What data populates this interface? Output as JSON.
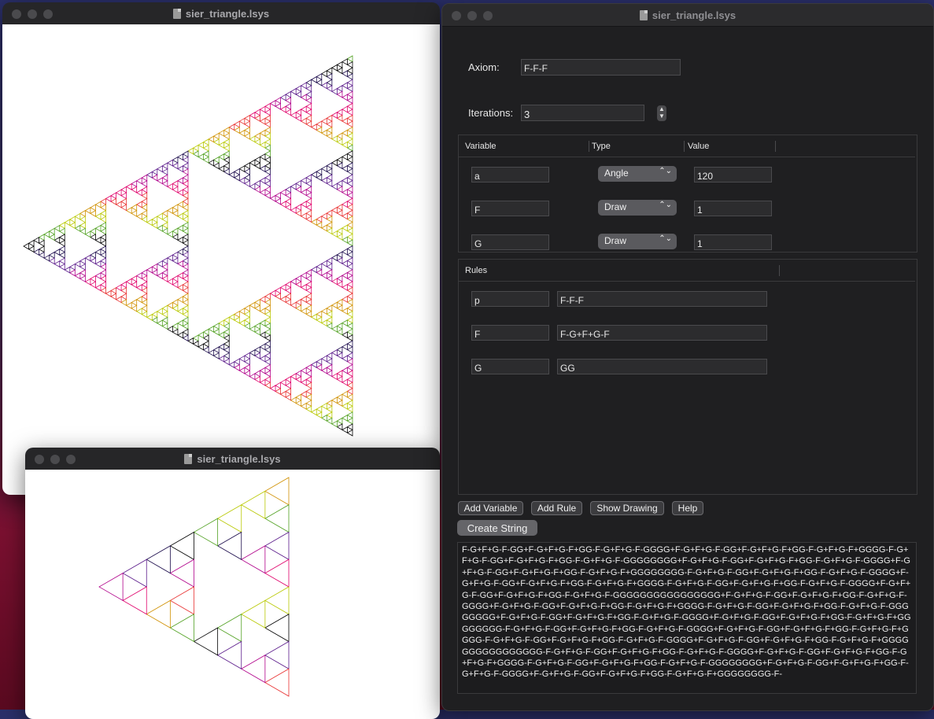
{
  "window_title": "sier_triangle.lsys",
  "axiom": {
    "label": "Axiom:",
    "value": "F-F-F"
  },
  "iterations": {
    "label": "Iterations:",
    "value": "3"
  },
  "variables": {
    "headers": [
      "Variable",
      "Type",
      "Value"
    ],
    "rows": [
      {
        "name": "a",
        "type": "Angle",
        "value": "120"
      },
      {
        "name": "F",
        "type": "Draw",
        "value": "1"
      },
      {
        "name": "G",
        "type": "Draw",
        "value": "1"
      }
    ]
  },
  "rules": {
    "header": "Rules",
    "rows": [
      {
        "name": "p",
        "value": "F-F-F"
      },
      {
        "name": "F",
        "value": "F-G+F+G-F"
      },
      {
        "name": "G",
        "value": "GG"
      }
    ]
  },
  "buttons": {
    "add_variable": "Add Variable",
    "add_rule": "Add Rule",
    "show_drawing": "Show Drawing",
    "help": "Help",
    "create_string": "Create String"
  },
  "icons": {
    "window_controls": "traffic-light-icons",
    "document": "document-icon",
    "popup": "chevron-up-down-icon",
    "stepper": "stepper-arrows-icon"
  },
  "drawing": {
    "shape": "sierpinski-triangle",
    "large_depth": 6,
    "small_depth": 3,
    "colors": [
      "#000000",
      "#1a0a4a",
      "#5a1a8a",
      "#b0008a",
      "#e0006a",
      "#e83030",
      "#d09000",
      "#b8c800",
      "#50a020"
    ]
  },
  "output_text": "F-G+F+G-F-GG+F-G+F+G-F+GG-F-G+F+G-F-GGGG+F-G+F+G-F-GG+F-G+F+G-F+GG-F-G+F+G-F+GGGG-F-G+F+G-F-GG+F-G+F+G-F+GG-F-G+F+G-F-GGGGGGGG+F-G+F+G-F-GG+F-G+F+G-F+GG-F-G+F+G-F-GGGG+F-G+F+G-F-GG+F-G+F+G-F+GG-F-G+F+G-F+GGGGGGGG-F-G+F+G-F-GG+F-G+F+G-F+GG-F-G+F+G-F-GGGG+F-G+F+G-F-GG+F-G+F+G-F+GG-F-G+F+G-F+GGGG-F-G+F+G-F-GG+F-G+F+G-F+GG-F-G+F+G-F-GGGG+F-G+F+G-F-GG+F-G+F+G-F+GG-F-G+F+G-F-GGGGGGGGGGGGGGGG+F-G+F+G-F-GG+F-G+F+G-F+GG-F-G+F+G-F-GGGG+F-G+F+G-F-GG+F-G+F+G-F+GG-F-G+F+G-F+GGGG-F-G+F+G-F-GG+F-G+F+G-F+GG-F-G+F+G-F-GGGGGGGG+F-G+F+G-F-GG+F-G+F+G-F+GG-F-G+F+G-F-GGGG+F-G+F+G-F-GG+F-G+F+G-F+GG-F-G+F+G-F+GGGGGGGG-F-G+F+G-F-GG+F-G+F+G-F+GG-F-G+F+G-F-GGGG+F-G+F+G-F-GG+F-G+F+G-F+GG-F-G+F+G-F+GGGG-F-G+F+G-F-GG+F-G+F+G-F+GG-F-G+F+G-F-GGGG+F-G+F+G-F-GG+F-G+F+G-F+GG-F-G+F+G-F+GGGGGGGGGGGGGGGG-F-G+F+G-F-GG+F-G+F+G-F+GG-F-G+F+G-F-GGGG+F-G+F+G-F-GG+F-G+F+G-F+GG-F-G+F+G-F+GGGG-F-G+F+G-F-GG+F-G+F+G-F+GG-F-G+F+G-F-GGGGGGGG+F-G+F+G-F-GG+F-G+F+G-F+GG-F-G+F+G-F-GGGG+F-G+F+G-F-GG+F-G+F+G-F+GG-F-G+F+G-F+GGGGGGGG-F-"
}
